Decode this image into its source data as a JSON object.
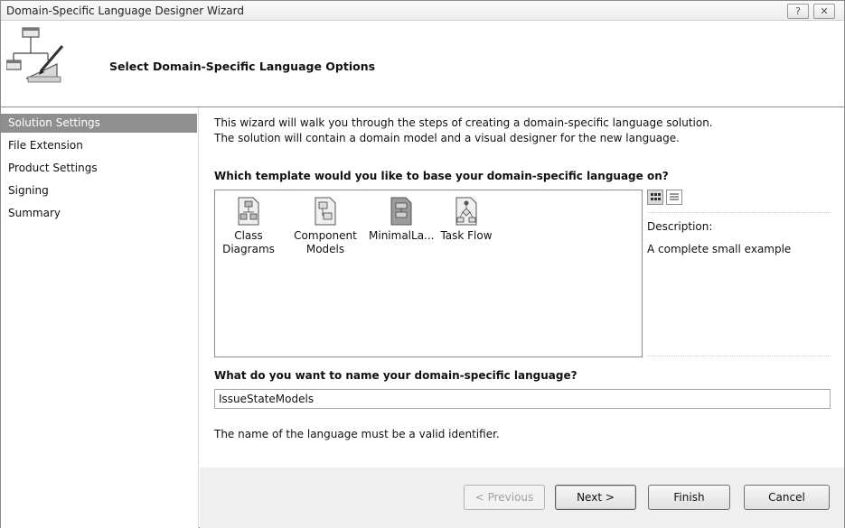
{
  "window": {
    "title": "Domain-Specific Language Designer Wizard",
    "help_button": "?",
    "close_button": "✕"
  },
  "header": {
    "title": "Select Domain-Specific Language Options",
    "icon": "designer-diagram-icon"
  },
  "nav": {
    "items": [
      {
        "label": "Solution Settings",
        "selected": true
      },
      {
        "label": "File Extension",
        "selected": false
      },
      {
        "label": "Product Settings",
        "selected": false
      },
      {
        "label": "Signing",
        "selected": false
      },
      {
        "label": "Summary",
        "selected": false
      }
    ]
  },
  "content": {
    "intro_line1": "This wizard will walk you through the steps of creating a domain-specific language solution.",
    "intro_line2": "The solution will contain a domain model and a visual designer for the new language.",
    "template_question": "Which template would you like to base your domain-specific language on?",
    "templates": [
      {
        "label_line1": "Class",
        "label_line2": "Diagrams",
        "icon": "class-diagram-icon",
        "selected": false
      },
      {
        "label_line1": "Component",
        "label_line2": "Models",
        "icon": "component-model-icon",
        "selected": false
      },
      {
        "label_line1": "MinimalLa...",
        "label_line2": "",
        "icon": "minimal-language-icon",
        "selected": true
      },
      {
        "label_line1": "Task Flow",
        "label_line2": "",
        "icon": "task-flow-icon",
        "selected": false
      }
    ],
    "view_buttons": [
      {
        "icon": "large-icons-view-icon",
        "active": true
      },
      {
        "icon": "list-view-icon",
        "active": false
      }
    ],
    "description_label": "Description:",
    "description_text": "A complete small example",
    "name_question": "What do you want to name your domain-specific language?",
    "name_value": "IssueStateModels",
    "name_hint": "The name of the language must be a valid identifier."
  },
  "footer": {
    "previous_label": "< Previous",
    "next_label": "Next >",
    "finish_label": "Finish",
    "cancel_label": "Cancel"
  }
}
